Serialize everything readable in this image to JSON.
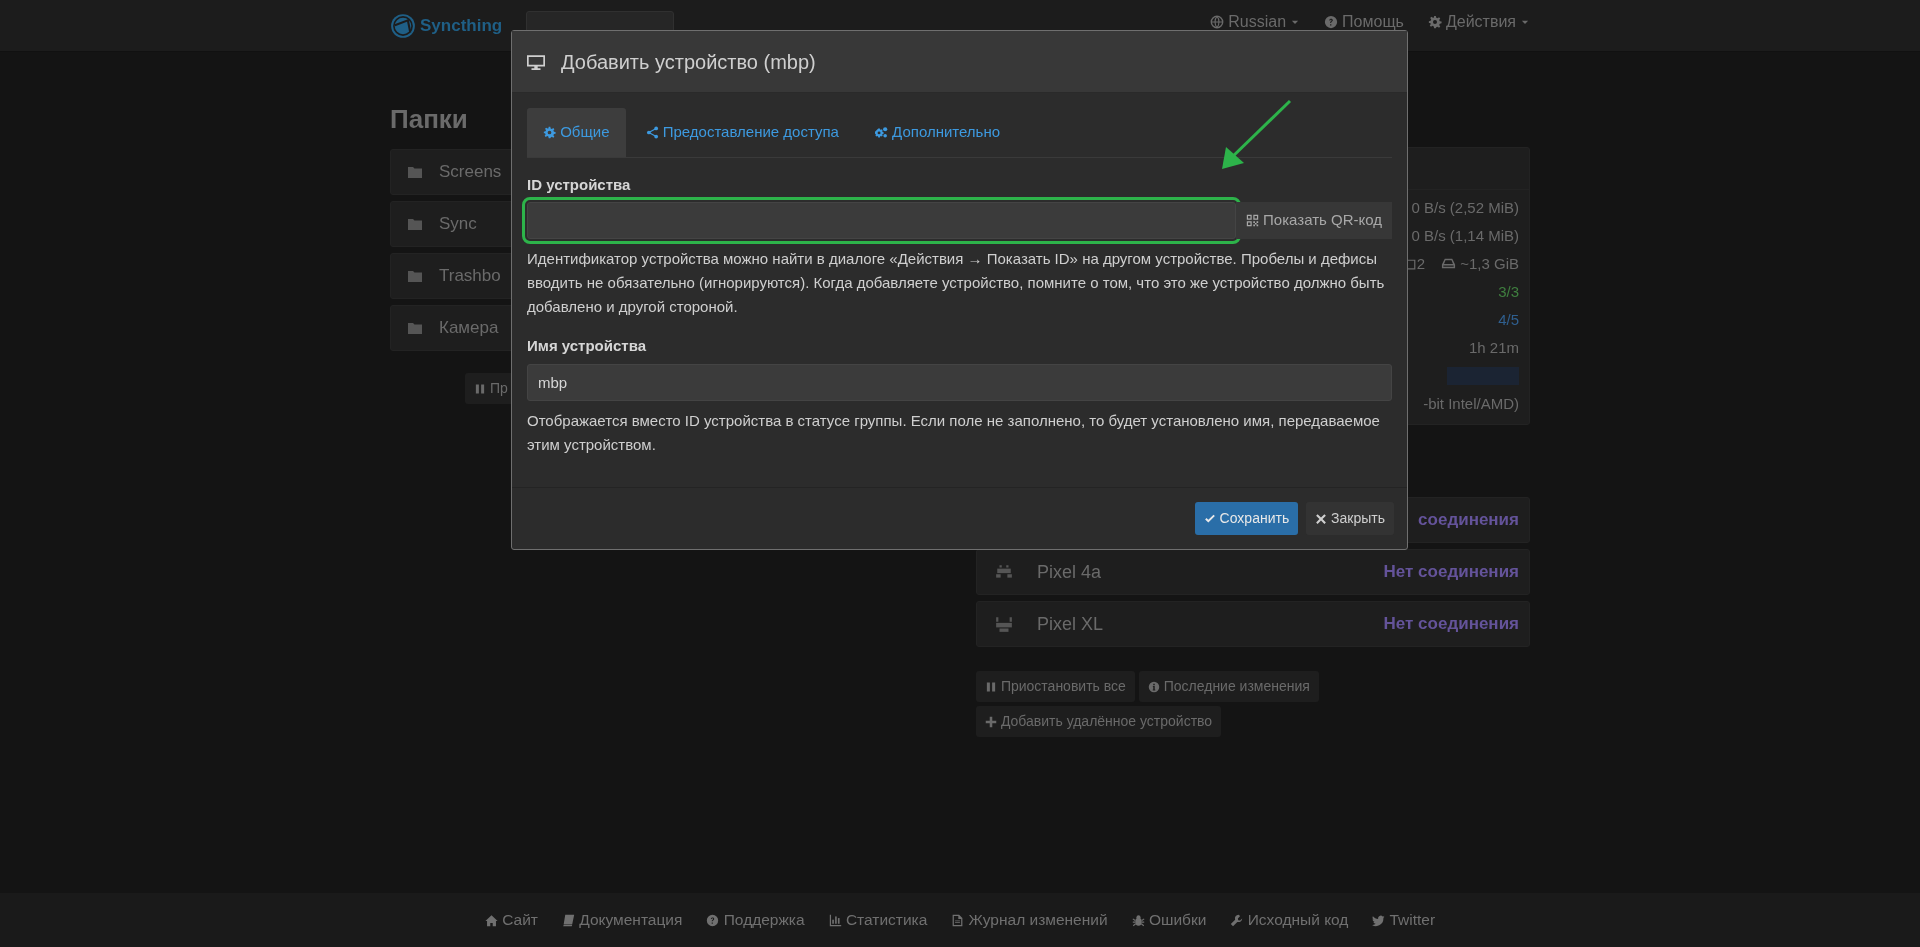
{
  "navbar": {
    "brand": "Syncthing",
    "menu": [
      {
        "label": "Russian",
        "caret": true
      },
      {
        "label": "Помощь",
        "caret": false
      },
      {
        "label": "Действия",
        "caret": true
      }
    ]
  },
  "folders": {
    "heading": "Папки",
    "items": [
      {
        "name": "Screens"
      },
      {
        "name": "Sync"
      },
      {
        "name": "Trashbo"
      },
      {
        "name": "Камера"
      }
    ],
    "button": {
      "label": "Пр"
    }
  },
  "this_device": {
    "rows": [
      {
        "kind": "text",
        "value": "0 B/s (2,52 MiB)"
      },
      {
        "kind": "text",
        "value": "0 B/s (1,14 MiB)"
      },
      {
        "kind": "storage",
        "count": "2",
        "size": "~1,3 GiB"
      },
      {
        "kind": "text",
        "value": "3/3",
        "color": "#3f7f3f"
      },
      {
        "kind": "text",
        "value": "4/5",
        "color": "#2f5f8f"
      },
      {
        "kind": "text",
        "value": "1h 21m"
      },
      {
        "kind": "bar"
      },
      {
        "kind": "text",
        "value": "-bit Intel/AMD)"
      }
    ]
  },
  "devices": [
    {
      "status": "соединения"
    },
    {
      "name": "Pixel 4a",
      "status": "Нет соединения"
    },
    {
      "name": "Pixel XL",
      "status": "Нет соединения"
    }
  ],
  "device_buttons": [
    {
      "label": "Приостановить все"
    },
    {
      "label": "Последние изменения"
    },
    {
      "label": "Добавить удалённое устройство"
    }
  ],
  "footer_links": [
    {
      "label": "Сайт"
    },
    {
      "label": "Документация"
    },
    {
      "label": "Поддержка"
    },
    {
      "label": "Статистика"
    },
    {
      "label": "Журнал изменений"
    },
    {
      "label": "Ошибки"
    },
    {
      "label": "Исходный код"
    },
    {
      "label": "Twitter"
    }
  ],
  "modal": {
    "title": "Добавить устройство (mbp)",
    "tabs": [
      {
        "label": "Общие",
        "selected": true
      },
      {
        "label": "Предоставление доступа",
        "selected": false
      },
      {
        "label": "Дополнительно",
        "selected": false
      }
    ],
    "device_id": {
      "label": "ID устройства",
      "highlighted": true,
      "qr_button": "Показать QR-код",
      "help": "Идентификатор устройства можно найти в диалоге «Действия → Показать ID» на другом устройстве. Пробелы и дефисы вводить не обязательно (игнорируются). Когда добавляете устройство, помните о том, что это же устройство должно быть добавлено и другой стороной."
    },
    "device_name": {
      "label": "Имя устройства",
      "value": "mbp",
      "help": "Отображается вместо ID устройства в статусе группы. Если поле не заполнено, то будет установлено имя, передаваемое этим устройством."
    },
    "buttons": [
      {
        "kind": "primary",
        "label": "Сохранить"
      },
      {
        "kind": "default",
        "label": "Закрыть"
      }
    ]
  }
}
